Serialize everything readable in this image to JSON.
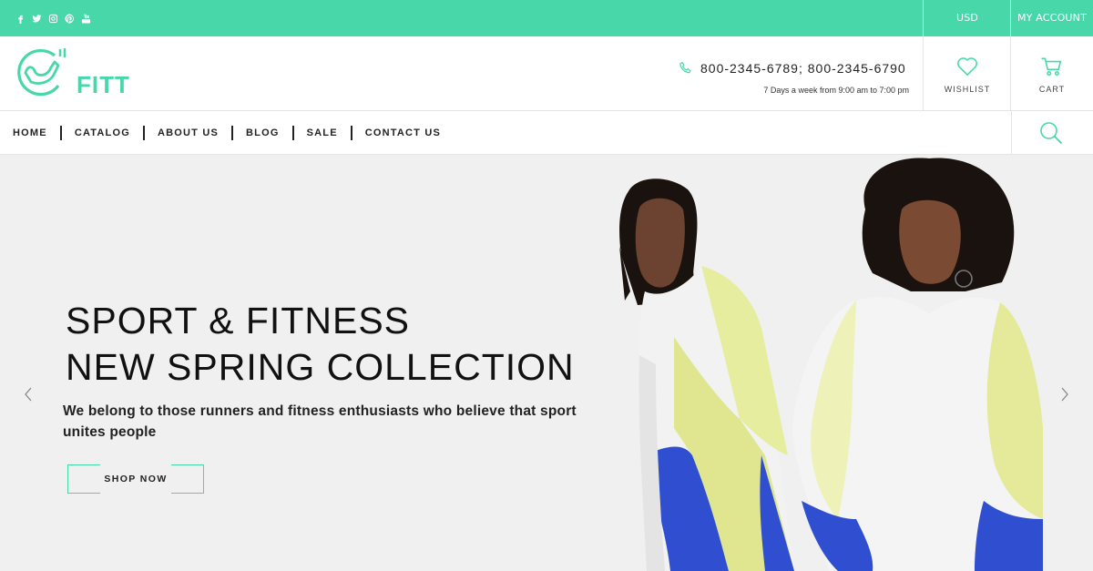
{
  "topbar": {
    "social_icons": [
      "facebook-icon",
      "twitter-icon",
      "instagram-icon",
      "pinterest-icon",
      "youtube-icon"
    ],
    "currency": "USD",
    "account": "MY ACCOUNT",
    "color": "#47d7a9"
  },
  "header": {
    "logo_text": "FITT",
    "phone": "800-2345-6789; 800-2345-6790",
    "hours": "7 Days a week from 9:00 am to 7:00 pm",
    "wishlist": "WISHLIST",
    "cart": "CART"
  },
  "nav": {
    "items": [
      "HOME",
      "CATALOG",
      "ABOUT US",
      "BLOG",
      "SALE",
      "CONTACT US"
    ]
  },
  "hero": {
    "line1": "SPORT & FITNESS",
    "line2": "NEW SPRING COLLECTION",
    "description": "We belong to those runners and fitness enthusiasts who believe that sport unites people",
    "button": "SHOP NOW"
  },
  "colors": {
    "accent": "#47d7a9",
    "hero_bg": "#f0f0f0"
  }
}
